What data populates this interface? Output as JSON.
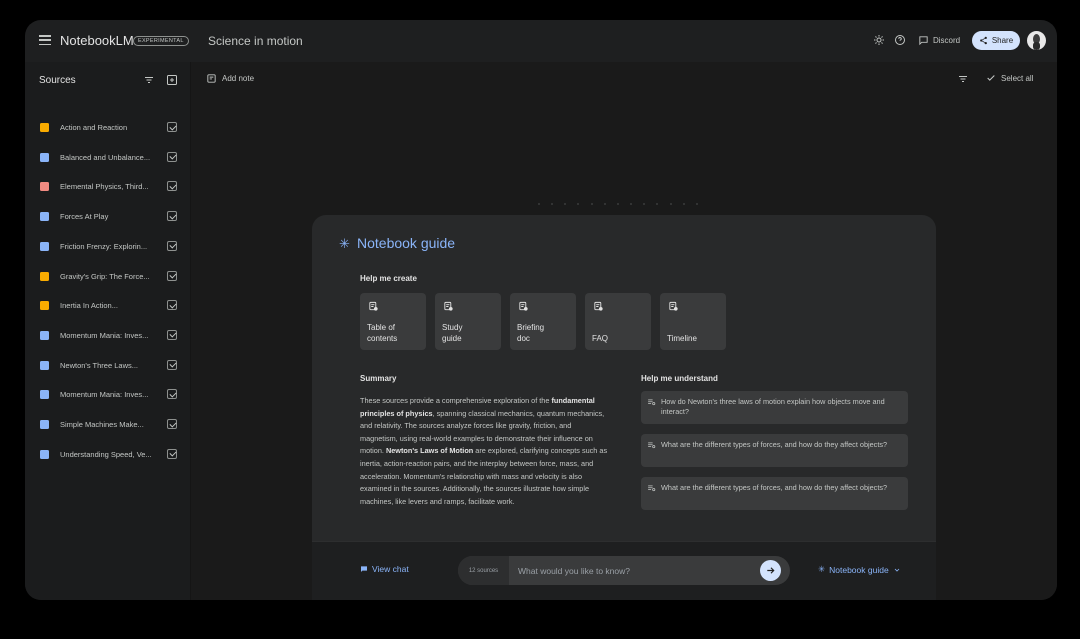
{
  "app": {
    "brand": "NotebookLM",
    "badge": "EXPERIMENTAL",
    "notebook_title": "Science in motion"
  },
  "topbar": {
    "discord_label": "Discord",
    "share_label": "Share"
  },
  "sidebar": {
    "heading": "Sources",
    "items": [
      {
        "label": "Action and Reaction",
        "color": "#f9ab00"
      },
      {
        "label": "Balanced and Unbalance...",
        "color": "#8ab4f8"
      },
      {
        "label": "Elemental Physics, Third...",
        "color": "#f28b82"
      },
      {
        "label": "Forces At Play",
        "color": "#8ab4f8"
      },
      {
        "label": "Friction Frenzy: Explorin...",
        "color": "#8ab4f8"
      },
      {
        "label": "Gravity's Grip: The Force...",
        "color": "#f9ab00"
      },
      {
        "label": "Inertia In Action...",
        "color": "#f9ab00"
      },
      {
        "label": "Momentum Mania: Inves...",
        "color": "#8ab4f8"
      },
      {
        "label": "Newton's Three Laws...",
        "color": "#8ab4f8"
      },
      {
        "label": "Momentum Mania: Inves...",
        "color": "#8ab4f8"
      },
      {
        "label": "Simple Machines Make...",
        "color": "#8ab4f8"
      },
      {
        "label": "Understanding Speed, Ve...",
        "color": "#8ab4f8"
      }
    ]
  },
  "main": {
    "add_note_label": "Add note",
    "select_all_label": "Select all"
  },
  "guide": {
    "title": "Notebook guide",
    "help_create_label": "Help me create",
    "create_cards": [
      {
        "label": "Table of\ncontents"
      },
      {
        "label": "Study\nguide"
      },
      {
        "label": "Briefing\ndoc"
      },
      {
        "label": "FAQ"
      },
      {
        "label": "Timeline"
      }
    ],
    "summary_label": "Summary",
    "summary": {
      "p1": "These sources provide a comprehensive exploration of the ",
      "b1": "fundamental principles of physics",
      "p2": ", spanning classical mechanics, quantum mechanics, and relativity. The sources analyze forces like gravity, friction, and magnetism, using real-world examples to demonstrate their influence on motion. ",
      "b2": "Newton's Laws of Motion",
      "p3": " are explored, clarifying concepts such as inertia, action-reaction pairs, and the interplay between force, mass, and acceleration. Momentum's relationship with mass and velocity is also examined in the sources. Additionally, the sources illustrate how simple machines, like levers and ramps, facilitate work."
    },
    "help_understand_label": "Help me understand",
    "questions": [
      {
        "text": "How do Newton's three laws of motion explain how objects move and interact?"
      },
      {
        "text": "What are the different types of forces, and how do they affect objects?"
      },
      {
        "text": "What are the different types of forces, and how do they affect objects?"
      }
    ]
  },
  "bottom": {
    "view_chat_label": "View chat",
    "source_count": "12 sources",
    "chat_placeholder": "What would you like to know?",
    "notebook_guide_label": "Notebook guide"
  }
}
